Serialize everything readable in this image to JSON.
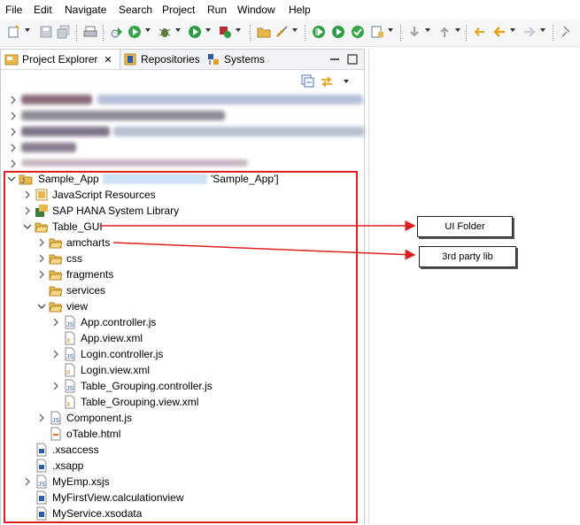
{
  "menubar": {
    "items": [
      {
        "label": "File"
      },
      {
        "label": "Edit"
      },
      {
        "label": "Navigate"
      },
      {
        "label": "Search"
      },
      {
        "label": "Project"
      },
      {
        "label": "Run"
      },
      {
        "label": "Window"
      },
      {
        "label": "Help"
      }
    ]
  },
  "tabs": [
    {
      "label": "Project Explorer"
    },
    {
      "label": "Repositories"
    },
    {
      "label": "Systems"
    }
  ],
  "tree": {
    "project": {
      "name": "Sample_App",
      "suffix": "'Sample_App']"
    },
    "items": [
      {
        "label": "JavaScript Resources"
      },
      {
        "label": "SAP HANA System Library"
      },
      {
        "label": "Table_GUI"
      },
      {
        "label": "amcharts"
      },
      {
        "label": "css"
      },
      {
        "label": "fragments"
      },
      {
        "label": "services"
      },
      {
        "label": "view"
      },
      {
        "label": "App.controller.js"
      },
      {
        "label": "App.view.xml"
      },
      {
        "label": "Login.controller.js"
      },
      {
        "label": "Login.view.xml"
      },
      {
        "label": "Table_Grouping.controller.js"
      },
      {
        "label": "Table_Grouping.view.xml"
      },
      {
        "label": "Component.js"
      },
      {
        "label": "oTable.html"
      },
      {
        "label": ".xsaccess"
      },
      {
        "label": ".xsapp"
      },
      {
        "label": "MyEmp.xsjs"
      },
      {
        "label": "MyFirstView.calculationview"
      },
      {
        "label": "MyService.xsodata"
      }
    ]
  },
  "callouts": {
    "ui_folder": "UI Folder",
    "third_party": "3rd party lib"
  },
  "colors": {
    "annotation_red": "#e02020",
    "folder_yellow": "#e8b84a",
    "selection_blue": "#cfe3f7"
  }
}
